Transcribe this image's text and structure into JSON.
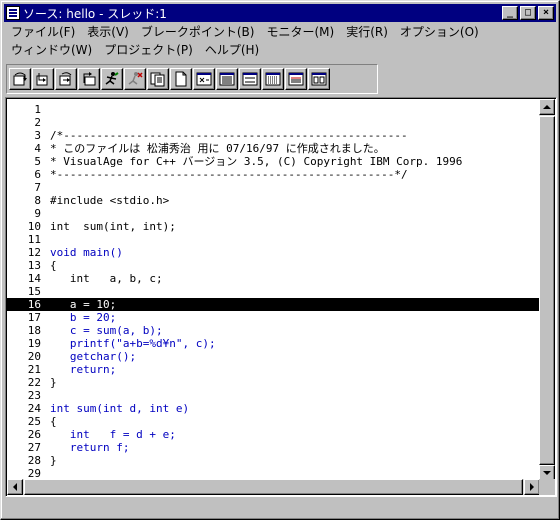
{
  "window": {
    "title": "ソース: hello - スレッド:1",
    "min_label": "_",
    "max_label": "□",
    "close_label": "×"
  },
  "menu": [
    "ファイル(F)",
    "表示(V)",
    "ブレークポイント(B)",
    "モニター(M)",
    "実行(R)",
    "オプション(O)",
    "ウィンドウ(W)",
    "プロジェクト(P)",
    "ヘルプ(H)"
  ],
  "toolbar": [
    {
      "name": "step-over-icon"
    },
    {
      "name": "step-into-icon"
    },
    {
      "name": "step-debug-icon"
    },
    {
      "name": "step-return-icon"
    },
    {
      "name": "run-icon"
    },
    {
      "name": "halt-icon"
    },
    {
      "name": "monitor-icon"
    },
    {
      "name": "storage-icon"
    },
    {
      "name": "variables-icon"
    },
    {
      "name": "stack-icon"
    },
    {
      "name": "registers-icon"
    },
    {
      "name": "breakpoints-icon"
    },
    {
      "name": "source-icon"
    },
    {
      "name": "window-icon"
    }
  ],
  "source": {
    "current_line": 16,
    "lines": [
      {
        "n": "1",
        "text": "",
        "blue": false
      },
      {
        "n": "2",
        "text": "",
        "blue": false
      },
      {
        "n": "3",
        "text": "/*----------------------------------------------------",
        "blue": false
      },
      {
        "n": "4",
        "text": "* このファイルは 松浦秀治 用に 07/16/97 に作成されました。",
        "blue": false
      },
      {
        "n": "5",
        "text": "* VisualAge for C++ バージョン 3.5, (C) Copyright IBM Corp. 1996",
        "blue": false
      },
      {
        "n": "6",
        "text": "*---------------------------------------------------*/",
        "blue": false
      },
      {
        "n": "7",
        "text": "",
        "blue": false
      },
      {
        "n": "8",
        "text": "#include <stdio.h>",
        "blue": false
      },
      {
        "n": "9",
        "text": "",
        "blue": false
      },
      {
        "n": "10",
        "text": "int  sum(int, int);",
        "blue": false
      },
      {
        "n": "11",
        "text": "",
        "blue": false
      },
      {
        "n": "12",
        "text": "void main()",
        "blue": true
      },
      {
        "n": "13",
        "text": "{",
        "blue": false
      },
      {
        "n": "14",
        "text": "   int   a, b, c;",
        "blue": false
      },
      {
        "n": "15",
        "text": "",
        "blue": false
      },
      {
        "n": "16",
        "text": "   a = 10;",
        "blue": false
      },
      {
        "n": "17",
        "text": "   b = 20;",
        "blue": true
      },
      {
        "n": "18",
        "text": "   c = sum(a, b);",
        "blue": true
      },
      {
        "n": "19",
        "text": "   printf(\"a+b=%d¥n\", c);",
        "blue": true
      },
      {
        "n": "20",
        "text": "   getchar();",
        "blue": true
      },
      {
        "n": "21",
        "text": "   return;",
        "blue": true
      },
      {
        "n": "22",
        "text": "}",
        "blue": false
      },
      {
        "n": "23",
        "text": "",
        "blue": false
      },
      {
        "n": "24",
        "text": "int sum(int d, int e)",
        "blue": true
      },
      {
        "n": "25",
        "text": "{",
        "blue": false
      },
      {
        "n": "26",
        "text": "   int   f = d + e;",
        "blue": true
      },
      {
        "n": "27",
        "text": "   return f;",
        "blue": true
      },
      {
        "n": "28",
        "text": "}",
        "blue": false
      },
      {
        "n": "29",
        "text": "",
        "blue": false
      }
    ]
  },
  "colors": {
    "titlebar": "#000080",
    "code_blue": "#0000c0",
    "current_line_bg": "#000000"
  }
}
